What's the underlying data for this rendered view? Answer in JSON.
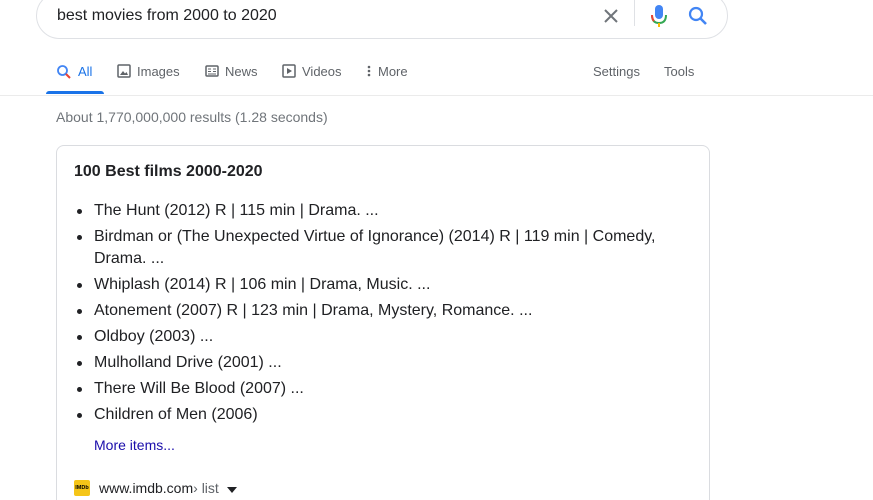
{
  "search": {
    "query": "best movies from 2000 to 2020",
    "clear_icon": "close-icon",
    "mic_icon": "microphone-icon",
    "search_icon": "search-icon"
  },
  "tabs": [
    {
      "label": "All",
      "icon": "search-icon",
      "active": true
    },
    {
      "label": "Images",
      "icon": "image-icon"
    },
    {
      "label": "News",
      "icon": "news-icon"
    },
    {
      "label": "Videos",
      "icon": "play-icon"
    },
    {
      "label": "More",
      "icon": "more-vert-icon"
    }
  ],
  "tools": {
    "settings": "Settings",
    "tools": "Tools"
  },
  "stats": "About 1,770,000,000 results (1.28 seconds)",
  "card": {
    "title": "100 Best films 2000-2020",
    "items": [
      "The Hunt (2012) R | 115 min | Drama. ...",
      "Birdman or (The Unexpected Virtue of Ignorance) (2014) R | 119 min | Comedy, Drama. ...",
      "Whiplash (2014) R | 106 min | Drama, Music. ...",
      "Atonement (2007) R | 123 min | Drama, Mystery, Romance. ...",
      "Oldboy (2003) ...",
      "Mulholland Drive (2001) ...",
      "There Will Be Blood (2007) ...",
      "Children of Men (2006)"
    ],
    "more_items": "More items...",
    "source_logo_text": "IMDb",
    "source_domain": "www.imdb.com",
    "source_breadcrumb": " › list"
  },
  "colors": {
    "accent": "#1a73e8",
    "link": "#1a0dab",
    "muted": "#5f6368",
    "stats": "#70757a"
  }
}
